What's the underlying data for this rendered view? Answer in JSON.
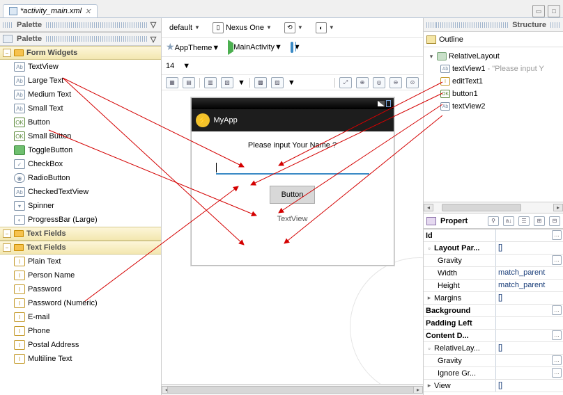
{
  "tab": {
    "label": "*activity_main.xml"
  },
  "palette": {
    "title": "Palette",
    "category_form": "Form Widgets",
    "items_form": [
      "TextView",
      "Large Text",
      "Medium Text",
      "Small Text",
      "Button",
      "Small Button",
      "ToggleButton",
      "CheckBox",
      "RadioButton",
      "CheckedTextView",
      "Spinner",
      "ProgressBar (Large)"
    ],
    "category_text": "Text Fields",
    "items_text": [
      "Plain Text",
      "Person Name",
      "Password",
      "Password (Numeric)",
      "E-mail",
      "Phone",
      "Postal Address",
      "Multiline Text"
    ]
  },
  "mid": {
    "config": "default",
    "device": "Nexus One",
    "theme": "AppTheme",
    "activity": "MainActivity",
    "api": "14"
  },
  "preview": {
    "app_name": "MyApp",
    "prompt": "Please input Your Name ?",
    "button": "Button",
    "tv": "TextView"
  },
  "structure": {
    "title": "Structure",
    "outline": "Outline",
    "root": "RelativeLayout",
    "n1": "textView1",
    "n1_hint": " - \"Please input Y",
    "n2": "editText1",
    "n3": "button1",
    "n4": "textView2"
  },
  "props": {
    "title": "Propert",
    "rows": {
      "id": "Id",
      "lp": "Layout Par...",
      "lp_v": "[]",
      "grav": "Gravity",
      "w": "Width",
      "w_v": "match_parent",
      "h": "Height",
      "h_v": "match_parent",
      "marg": "Margins",
      "marg_v": "[]",
      "bg": "Background",
      "padl": "Padding Left",
      "cd": "Content D...",
      "rl": "RelativeLay...",
      "rl_v": "[]",
      "grav2": "Gravity",
      "ig": "Ignore Gr...",
      "view": "View",
      "view_v": "[]"
    }
  }
}
